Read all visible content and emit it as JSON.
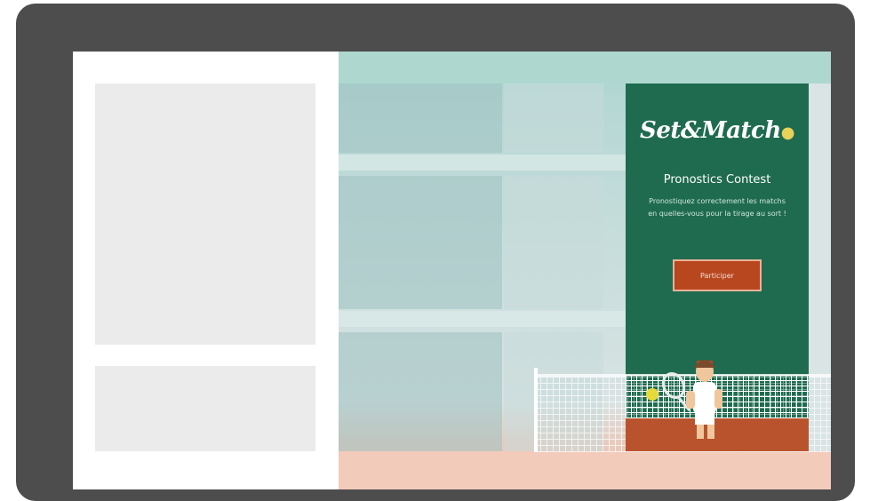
{
  "ad": {
    "logo_text": "Set&Match",
    "title": "Pronostics Contest",
    "description": "Pronostiquez correctement les matchs en quelles-vous pour la tirage au sort !",
    "cta_label": "Participer"
  },
  "colors": {
    "monitor_frame": "#4d4d4d",
    "ad_background": "#1f6b4f",
    "cta_background": "#b84720",
    "court_clay": "#b9532d",
    "placeholder": "#ebebeb"
  },
  "icons": [
    "tennis-player-illustration",
    "tennis-ball-icon",
    "tennis-racket-icon"
  ]
}
